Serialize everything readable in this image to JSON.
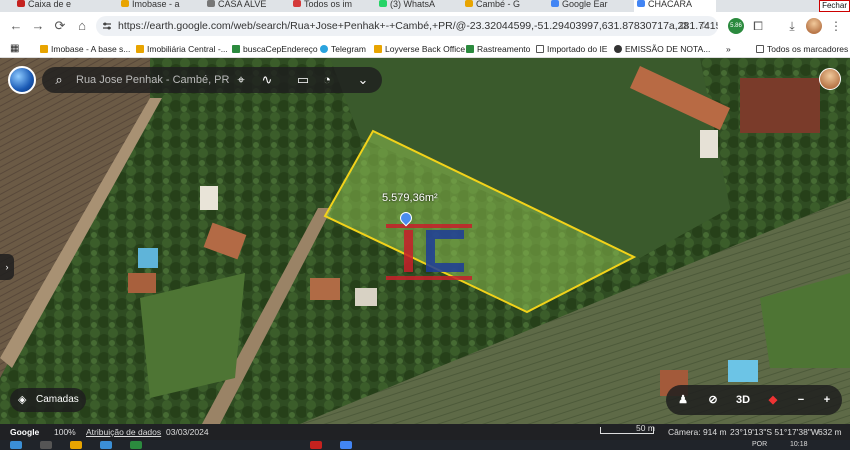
{
  "browser": {
    "tabs": [
      {
        "label": "Caixa de e",
        "color": "#c5221f"
      },
      {
        "label": "Imobase - a",
        "color": "#e8a400"
      },
      {
        "label": "CASA ALVE",
        "color": "#777"
      },
      {
        "label": "Todos os im",
        "color": "#d43a3a"
      },
      {
        "label": "(3) WhatsA",
        "color": "#25d366"
      },
      {
        "label": "Cambé - G",
        "color": "#e8a400"
      },
      {
        "label": "Google Ear",
        "color": "#4285f4"
      },
      {
        "label": "CHÁCARA",
        "color": "#4285f4"
      }
    ],
    "close_label": "Fechar",
    "url": "https://earth.google.com/web/search/Rua+Jose+Penhak+-+Cambé,+PR/@-23.32044599,-51.29403997,631.87830717a,281.74154379d,35y,0h...",
    "ext_badge": "5.86",
    "bookmarks": [
      {
        "label": "Imobase - A base s...",
        "color": "#e8a400"
      },
      {
        "label": "Imobiliária Central -...",
        "color": "#e8a400"
      },
      {
        "label": "buscaCepEndereço",
        "color": "#2b8a3e"
      },
      {
        "label": "Telegram",
        "color": "#2aa3de"
      },
      {
        "label": "Loyverse Back Office",
        "color": "#e8a400"
      },
      {
        "label": "Rastreamento",
        "color": "#2b8a3e"
      },
      {
        "label": "Importado do IE",
        "color": "#777"
      },
      {
        "label": "EMISSÃO DE NOTA...",
        "color": "#333"
      }
    ],
    "bookmarks_more": "»",
    "all_bookmarks": "Todos os marcadores"
  },
  "map": {
    "search_value": "Rua Jose Penhak - Cambé, PR",
    "area_label": "5.579,36m²",
    "layers_label": "Camadas",
    "view_mode": "3D"
  },
  "status": {
    "brand": "Google",
    "zoom": "100%",
    "attribution": "Atribuição de dados",
    "date": "03/03/2024",
    "scale": "50 m",
    "camera": "Câmera: 914 m",
    "coords": "23°19'13\"S 51°17'38\"W",
    "elevation": "632 m"
  },
  "taskbar": {
    "lang": "POR",
    "clock": "10:18"
  }
}
